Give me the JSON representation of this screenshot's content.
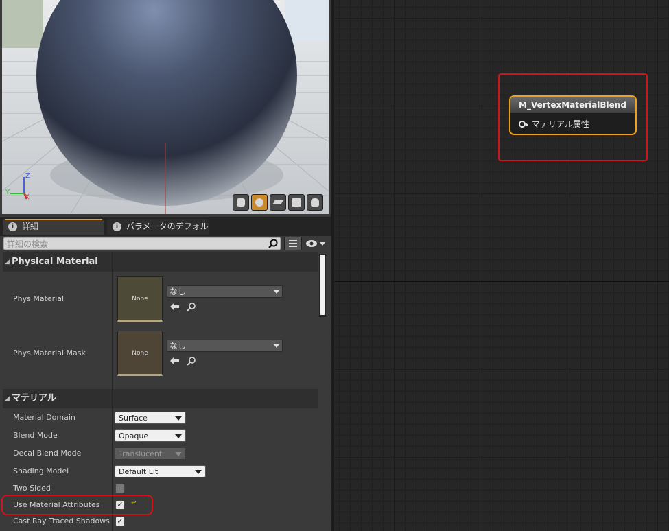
{
  "tabs": [
    {
      "label": "詳細"
    },
    {
      "label": "パラメータのデフォル"
    }
  ],
  "search": {
    "placeholder": "詳細の検索"
  },
  "axis": {
    "z": "Z",
    "y": "Y",
    "x": "X"
  },
  "categories": {
    "physical_material": "Physical Material",
    "material": "マテリアル"
  },
  "physical_material": {
    "phys_material": {
      "label": "Phys Material",
      "thumb": "None",
      "value": "なし"
    },
    "phys_material_mask": {
      "label": "Phys Material Mask",
      "thumb": "None",
      "value": "なし"
    }
  },
  "material": {
    "material_domain": {
      "label": "Material Domain",
      "value": "Surface"
    },
    "blend_mode": {
      "label": "Blend Mode",
      "value": "Opaque"
    },
    "decal_blend_mode": {
      "label": "Decal Blend Mode",
      "value": "Translucent"
    },
    "shading_model": {
      "label": "Shading Model",
      "value": "Default Lit"
    },
    "two_sided": {
      "label": "Two Sided",
      "checked": false
    },
    "use_material_attributes": {
      "label": "Use Material Attributes",
      "checked": true
    },
    "cast_ray_traced_shadows": {
      "label": "Cast Ray Traced Shadows",
      "checked": true
    }
  },
  "node": {
    "title": "M_VertexMaterialBlend",
    "pin_label": "マテリアル属性"
  },
  "colors": {
    "accent_orange": "#f0a018",
    "highlight_red": "#d0141a"
  }
}
